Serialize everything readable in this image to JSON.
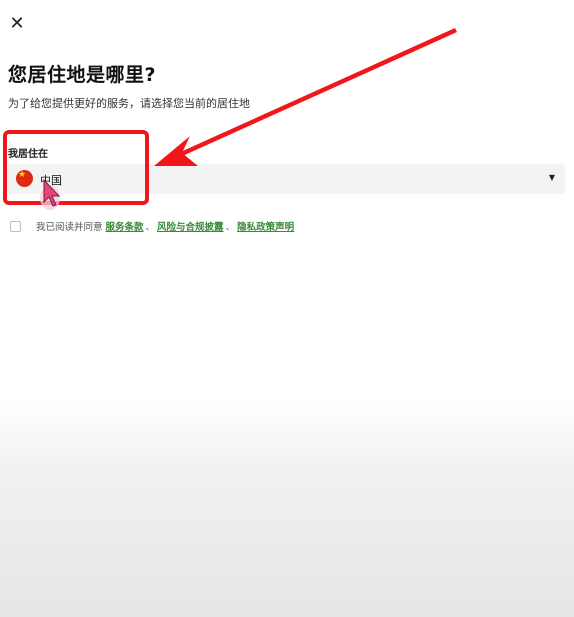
{
  "dialog": {
    "close_icon": "close-icon",
    "close_glyph": "✕",
    "title": "您居住地是哪里?",
    "subtitle": "为了给您提供更好的服务，请选择您当前的居住地"
  },
  "residence": {
    "label": "我居住在",
    "selected_value": "中国",
    "flag_icon": "china-flag-icon"
  },
  "agreement": {
    "prefix": "我已阅读并同意",
    "links": [
      "服务条款",
      "风险与合规披露",
      "隐私政策声明"
    ],
    "separator": "、",
    "link_color": "#3a8a3a"
  },
  "annotation": {
    "color": "#f0161c"
  }
}
